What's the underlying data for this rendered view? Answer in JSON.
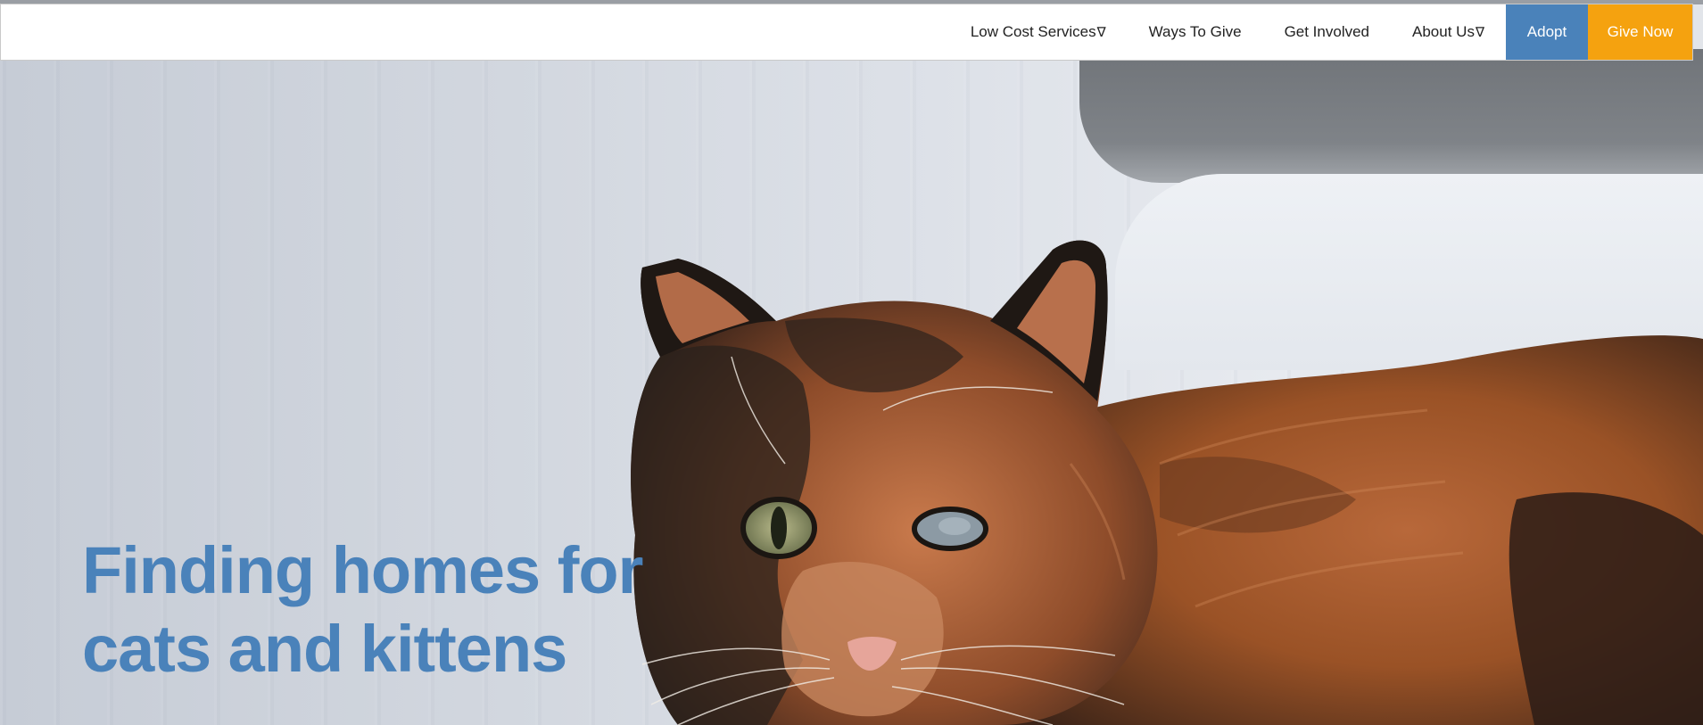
{
  "nav": {
    "items": [
      {
        "label": "Low Cost Services",
        "has_dropdown": true,
        "arrow": "∇"
      },
      {
        "label": "Ways To Give",
        "has_dropdown": false
      },
      {
        "label": "Get Involved",
        "has_dropdown": false
      },
      {
        "label": "About Us",
        "has_dropdown": true,
        "arrow": "∇"
      }
    ],
    "adopt_label": "Adopt",
    "give_label": "Give Now"
  },
  "hero": {
    "line1": "Finding homes for",
    "line2": "cats and kittens",
    "image": "calico-cat-photo"
  },
  "colors": {
    "accent_blue": "#4a82ba",
    "accent_orange": "#f5a20f"
  }
}
